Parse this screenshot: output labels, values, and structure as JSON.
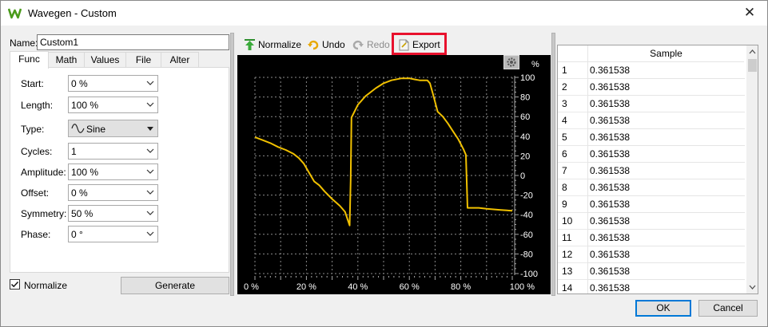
{
  "window": {
    "title": "Wavegen - Custom",
    "close_label": "✕"
  },
  "left_panel": {
    "name_label": "Name:",
    "name_value": "Custom1",
    "tabs": [
      {
        "label": "Func",
        "active": true
      },
      {
        "label": "Math",
        "active": false
      },
      {
        "label": "Values",
        "active": false
      },
      {
        "label": "File",
        "active": false
      },
      {
        "label": "Alter",
        "active": false
      }
    ],
    "fields": {
      "start": {
        "label": "Start:",
        "value": "0 %"
      },
      "length": {
        "label": "Length:",
        "value": "100 %"
      },
      "type": {
        "label": "Type:",
        "value": "Sine"
      },
      "cycles": {
        "label": "Cycles:",
        "value": "1"
      },
      "amplitude": {
        "label": "Amplitude:",
        "value": "100 %"
      },
      "offset": {
        "label": "Offset:",
        "value": "0 %"
      },
      "symmetry": {
        "label": "Symmetry:",
        "value": "50 %"
      },
      "phase": {
        "label": "Phase:",
        "value": "0 °"
      }
    },
    "normalize": {
      "label": "Normalize",
      "checked": true
    },
    "generate_label": "Generate"
  },
  "toolbar": {
    "normalize_label": "Normalize",
    "undo_label": "Undo",
    "redo_label": "Redo",
    "export_label": "Export",
    "highlighted_item": "Export",
    "highlight_color": "#e8112d"
  },
  "chart_data": {
    "type": "line",
    "title": "",
    "xlabel": "",
    "ylabel": "%",
    "xlim": [
      0,
      100
    ],
    "ylim": [
      -100,
      100
    ],
    "x_tick_labels": [
      "0 %",
      "20 %",
      "40 %",
      "60 %",
      "80 %",
      "100 %"
    ],
    "x_ticks": [
      0,
      20,
      40,
      60,
      80,
      100
    ],
    "y_ticks": [
      100,
      80,
      60,
      40,
      20,
      0,
      -20,
      -40,
      -60,
      -80,
      -100
    ],
    "y_tick_labels": [
      "100",
      "80",
      "60",
      "40",
      "20",
      "0",
      "-20",
      "-40",
      "-60",
      "-80",
      "-100"
    ],
    "background": "#000000",
    "grid": true,
    "grid_color": "#8a8a8a",
    "series": [
      {
        "color": "#f0c000",
        "x": [
          0,
          3,
          6,
          9,
          12,
          15,
          17,
          19,
          21,
          23,
          25,
          27,
          30,
          33,
          35,
          36.8,
          37.2,
          37.5,
          40,
          43,
          47,
          50,
          53,
          57,
          60,
          62,
          64,
          67,
          68,
          69.5,
          71,
          73,
          75,
          77,
          79,
          81,
          82,
          82.6,
          83.5,
          87,
          90,
          95,
          100
        ],
        "y": [
          39,
          36,
          33,
          29,
          26,
          22,
          18,
          12,
          3,
          -6,
          -10,
          -16,
          -24,
          -31,
          -37,
          -51,
          -5,
          59,
          72,
          81,
          89,
          94,
          97,
          99,
          99,
          98,
          97,
          97,
          94,
          80,
          65,
          60,
          53,
          45,
          37,
          27,
          21,
          -33,
          -33,
          -33,
          -34,
          -35,
          -36
        ]
      }
    ]
  },
  "settings_icon": "gear-icon",
  "table": {
    "header": "Sample",
    "rows": [
      {
        "index": "1",
        "value": "0.361538"
      },
      {
        "index": "2",
        "value": "0.361538"
      },
      {
        "index": "3",
        "value": "0.361538"
      },
      {
        "index": "4",
        "value": "0.361538"
      },
      {
        "index": "5",
        "value": "0.361538"
      },
      {
        "index": "6",
        "value": "0.361538"
      },
      {
        "index": "7",
        "value": "0.361538"
      },
      {
        "index": "8",
        "value": "0.361538"
      },
      {
        "index": "9",
        "value": "0.361538"
      },
      {
        "index": "10",
        "value": "0.361538"
      },
      {
        "index": "11",
        "value": "0.361538"
      },
      {
        "index": "12",
        "value": "0.361538"
      },
      {
        "index": "13",
        "value": "0.361538"
      },
      {
        "index": "14",
        "value": "0.361538"
      }
    ]
  },
  "footer": {
    "ok_label": "OK",
    "cancel_label": "Cancel"
  }
}
